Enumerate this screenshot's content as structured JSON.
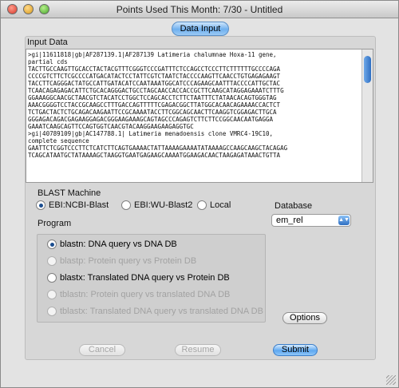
{
  "window": {
    "title": "Points Used This Month: 7/30 - Untitled"
  },
  "tabs": {
    "active": "Data Input"
  },
  "input_data": {
    "label": "Input Data",
    "text": ">gi|11611818|gb|AF287139.1|AF287139 Latimeria chalumnae Hoxa-11 gene,\npartial cds\nTACTTGCCAAGTTGCACCTACTACGTTTCGGGTCCCGATTTCTCCAGCCTCCCTTCTTTTTTGCCCCAGA\nCCCCGTCTTCTCGCCCCATGACATACTCCTATTCGTCTAATCTACCCCAAGTTCAACCTGTGAGAGAAGT\nTACCTTCAGGGACTATGCCATTGATACATCCAATAAATGGCATCCCAGAAGCAATTTACCCCATTGCTAC\nTCAACAGAGAGACATTCTGCACAGGGACTGCCTAGCAACCACCACCGCTTCAAGCATAGGAGAAATCTTTG\nGGAAAGGCAACGCTAACGTCTACATCCTGGCTCCAGCACCTCTTCTAATTTCTATAACACAGTGGGTAG\nAAACGGGGTCCTACCGCAAGCCTTTGACCAGTTTTTCGAGACGGCTTATGGCACAACAGAAAACCACTCT\nTCTGACTACTCTGCAGACAAGAATTCCGCAAAATACCTTCGGCAGCAACTTCAAGGTCGGAGACTTGCA\nGGGAGACAGACGAGAAGGAGACGGGAAGAAAGCAGTAGCCCAGAGTCTTCTTCCGGCAACAATGAGGA\nGAAATCAAGCAGTTCCAGTGGTCAACGTACAAGGAAGAAGAGGTGC\n>gi|40789109|gb|AC147788.1| Latimeria menadoensis clone VMRC4-19C10,\ncomplete sequence\nGAATTCTCGGTCCCTTCTCATCTTCAGTGAAAACTATTAAAAGAAAATATAAAAGCCAAGCAAGCTACAGAG\nTCAGCATAATGCTATAAAAGCTAAGGTGAATGAGAAGCAAAATGGAAGACAACTAAGAGATAAACTGTTA"
  },
  "blast_machine": {
    "label": "BLAST Machine",
    "options": [
      "EBI:NCBI-Blast",
      "EBI:WU-Blast2",
      "Local"
    ],
    "selected": "EBI:NCBI-Blast"
  },
  "database": {
    "label": "Database",
    "selected": "em_rel"
  },
  "program": {
    "label": "Program",
    "items": [
      {
        "label": "blastn: DNA query vs DNA DB",
        "enabled": true,
        "selected": true
      },
      {
        "label": "blastp: Protein query vs Protein DB",
        "enabled": false,
        "selected": false
      },
      {
        "label": "blastx: Translated DNA query vs Protein DB",
        "enabled": true,
        "selected": false
      },
      {
        "label": "tblastn: Protein query vs translated DNA DB",
        "enabled": false,
        "selected": false
      },
      {
        "label": "tblastx: Translated DNA query vs translated DNA DB",
        "enabled": false,
        "selected": false
      }
    ]
  },
  "buttons": {
    "options": "Options",
    "cancel": "Cancel",
    "resume": "Resume",
    "submit": "Submit"
  },
  "colors": {
    "accent": "#5ea8f0",
    "panel": "#d7d7d7",
    "window": "#e3e3e3"
  },
  "icons": [
    "close-icon",
    "minimize-icon",
    "zoom-icon",
    "chevron-updown-icon",
    "resize-grip-icon"
  ]
}
